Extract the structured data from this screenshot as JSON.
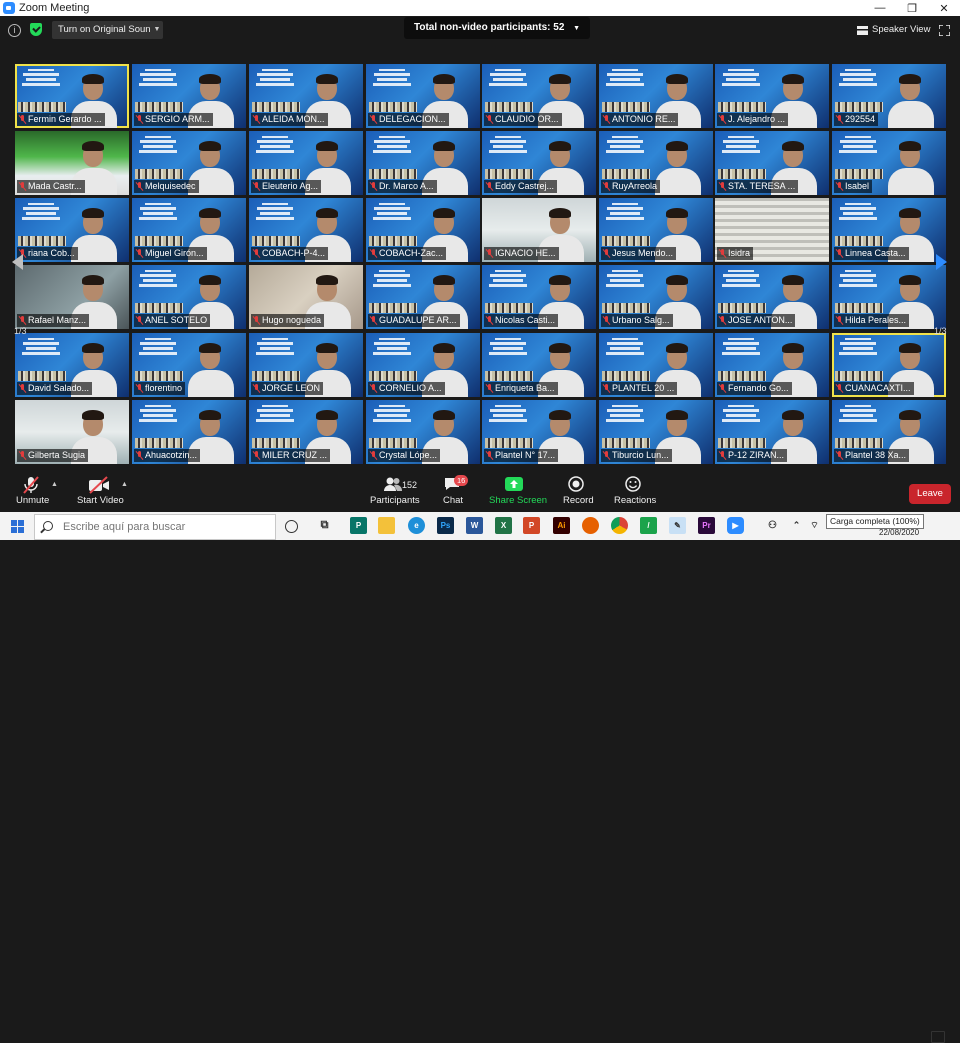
{
  "window": {
    "title": "Zoom Meeting",
    "controls": [
      "—",
      "❐",
      "✕"
    ]
  },
  "topbar": {
    "sound_button": "Turn on Original Sound",
    "non_video_label": "Total non-video participants: 52",
    "speaker_view": "Speaker View"
  },
  "gallery": {
    "page_indicator": "1/3",
    "tiles": [
      {
        "name": "Fermin Gerardo ...",
        "style": "poster",
        "highlight": true
      },
      {
        "name": "SERGIO ARM...",
        "style": "poster"
      },
      {
        "name": "ALEIDA MON...",
        "style": "poster"
      },
      {
        "name": "DELEGACION...",
        "style": "poster"
      },
      {
        "name": "CLAUDIO OR...",
        "style": "poster"
      },
      {
        "name": "ANTONIO RE...",
        "style": "poster"
      },
      {
        "name": "J. Alejandro ...",
        "style": "poster"
      },
      {
        "name": "292554",
        "style": "poster"
      },
      {
        "name": "Mada Castr...",
        "style": "green"
      },
      {
        "name": "Melquisedec",
        "style": "poster"
      },
      {
        "name": "Eleuterio Ag...",
        "style": "poster"
      },
      {
        "name": "Dr. Marco A...",
        "style": "poster"
      },
      {
        "name": "Eddy Castrej...",
        "style": "poster"
      },
      {
        "name": "RuyArreola",
        "style": "poster"
      },
      {
        "name": "STA. TERESA ...",
        "style": "poster"
      },
      {
        "name": "Isabel",
        "style": "poster"
      },
      {
        "name": "riana Cob...",
        "style": "poster"
      },
      {
        "name": "Miguel Girón...",
        "style": "poster"
      },
      {
        "name": "COBACH-P-4...",
        "style": "poster"
      },
      {
        "name": "COBACH-Zac...",
        "style": "poster"
      },
      {
        "name": "IGNACIO HE...",
        "style": "white"
      },
      {
        "name": "Jesus Mendo...",
        "style": "poster"
      },
      {
        "name": "Isidra",
        "style": "blind"
      },
      {
        "name": "Linnea Casta...",
        "style": "poster"
      },
      {
        "name": "Rafael Manz...",
        "style": "grey"
      },
      {
        "name": "ANEL SOTELO",
        "style": "poster"
      },
      {
        "name": "Hugo nogueda",
        "style": "wall"
      },
      {
        "name": "GUADALUPE AR...",
        "style": "poster"
      },
      {
        "name": "Nicolas Casti...",
        "style": "poster"
      },
      {
        "name": "Urbano Salg...",
        "style": "poster"
      },
      {
        "name": "JOSE ANTON...",
        "style": "poster"
      },
      {
        "name": "Hilda Perales...",
        "style": "poster"
      },
      {
        "name": "David Salado...",
        "style": "poster"
      },
      {
        "name": "florentino",
        "style": "poster"
      },
      {
        "name": "JORGE LEON",
        "style": "poster"
      },
      {
        "name": "CORNELIO A...",
        "style": "poster"
      },
      {
        "name": "Enriqueta Ba...",
        "style": "poster"
      },
      {
        "name": "PLANTEL 20 ...",
        "style": "poster"
      },
      {
        "name": "Fernando Go...",
        "style": "poster"
      },
      {
        "name": "CUANACAXTI...",
        "style": "poster",
        "highlight": true
      },
      {
        "name": "Gilberta Sugia",
        "style": "white"
      },
      {
        "name": "Ahuacotzin...",
        "style": "poster"
      },
      {
        "name": "MILER CRUZ ...",
        "style": "poster"
      },
      {
        "name": "Crystal Lópe...",
        "style": "poster"
      },
      {
        "name": "Plantel N° 17...",
        "style": "poster"
      },
      {
        "name": "Tiburcio Lun...",
        "style": "poster"
      },
      {
        "name": "P-12  ZIRAN...",
        "style": "poster"
      },
      {
        "name": "Plantel 38 Xa...",
        "style": "poster"
      }
    ]
  },
  "toolbar": {
    "unmute": "Unmute",
    "start_video": "Start Video",
    "participants": "Participants",
    "participants_count": "152",
    "chat": "Chat",
    "chat_badge": "16",
    "share_screen": "Share Screen",
    "record": "Record",
    "reactions": "Reactions",
    "leave": "Leave",
    "share_color": "#23d959",
    "leave_color": "#c9252c"
  },
  "taskbar": {
    "search_placeholder": "Escribe aquí para buscar",
    "apps": [
      "circle-icon",
      "task-view-icon",
      "publisher",
      "file-explorer",
      "edge",
      "photoshop",
      "word",
      "excel",
      "powerpoint",
      "illustrator",
      "firefox",
      "chrome",
      "snip",
      "notepad",
      "premiere",
      "zoom"
    ],
    "tooltip": "Carga completa (100%)",
    "date": "22/08/2020"
  }
}
